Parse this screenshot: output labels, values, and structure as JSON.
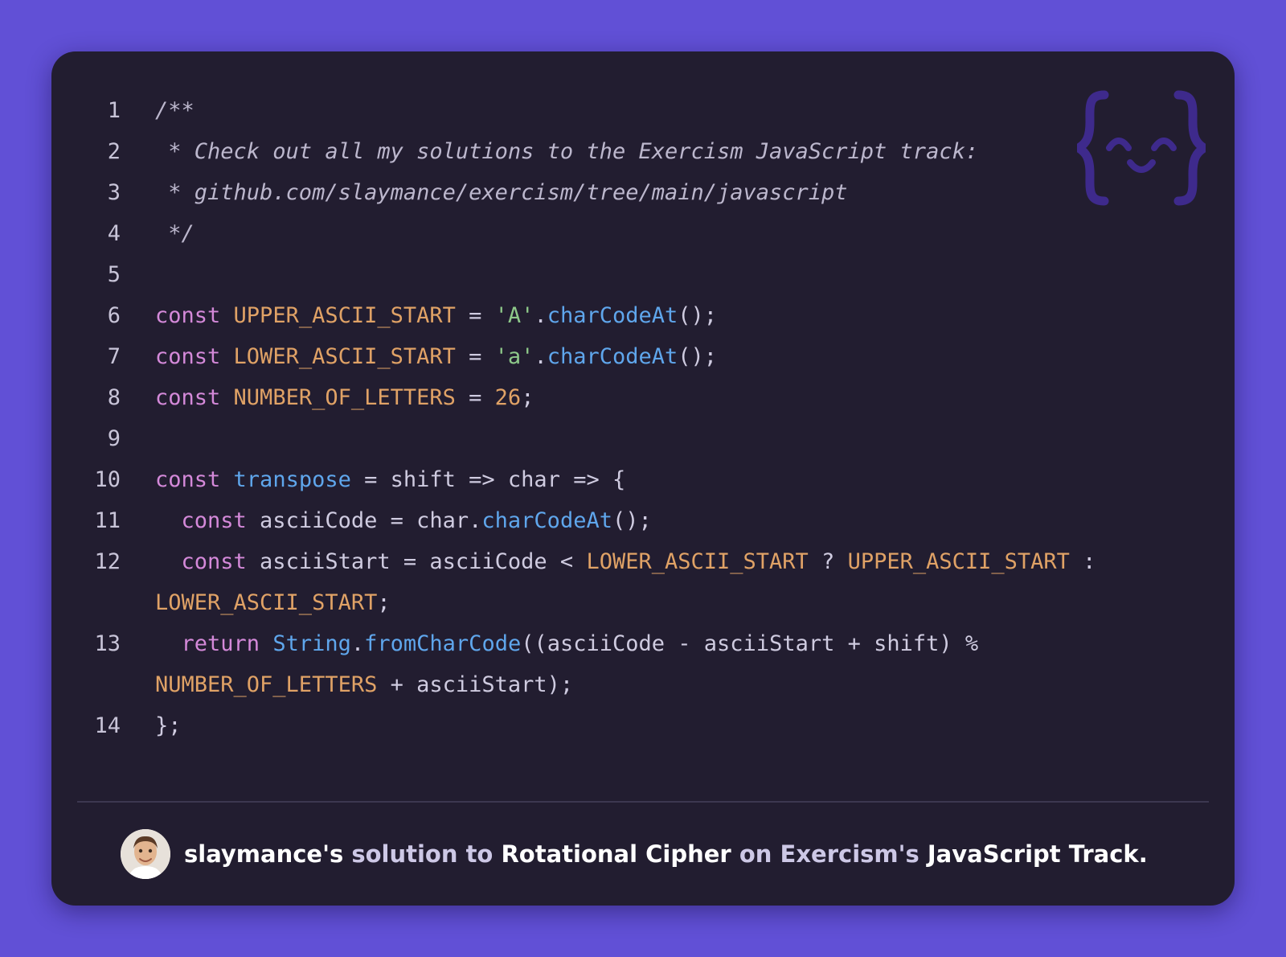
{
  "colors": {
    "background": "#6150d6",
    "card": "#221d30",
    "keyword": "#d489d9",
    "constant": "#e0a266",
    "function": "#5fa6ec",
    "string": "#8ec98a",
    "comment": "#bcb7cd",
    "text": "#cfcbe0"
  },
  "logo": {
    "icon": "exercism-curly-face-icon"
  },
  "code": {
    "line_numbers": [
      "1",
      "2",
      "3",
      "4",
      "5",
      "6",
      "7",
      "8",
      "9",
      "10",
      "11",
      "12",
      "13",
      "14"
    ],
    "lines": [
      [
        {
          "t": "cm",
          "v": "/**"
        }
      ],
      [
        {
          "t": "cm",
          "v": " * Check out all my solutions to the Exercism JavaScript track:"
        }
      ],
      [
        {
          "t": "cm",
          "v": " * github.com/slaymance/exercism/tree/main/javascript"
        }
      ],
      [
        {
          "t": "cm",
          "v": " */"
        }
      ],
      [],
      [
        {
          "t": "kw",
          "v": "const"
        },
        {
          "t": "tx",
          "v": " "
        },
        {
          "t": "cn",
          "v": "UPPER_ASCII_START"
        },
        {
          "t": "tx",
          "v": " = "
        },
        {
          "t": "st",
          "v": "'A'"
        },
        {
          "t": "tx",
          "v": "."
        },
        {
          "t": "fn",
          "v": "charCodeAt"
        },
        {
          "t": "tx",
          "v": "();"
        }
      ],
      [
        {
          "t": "kw",
          "v": "const"
        },
        {
          "t": "tx",
          "v": " "
        },
        {
          "t": "cn",
          "v": "LOWER_ASCII_START"
        },
        {
          "t": "tx",
          "v": " = "
        },
        {
          "t": "st",
          "v": "'a'"
        },
        {
          "t": "tx",
          "v": "."
        },
        {
          "t": "fn",
          "v": "charCodeAt"
        },
        {
          "t": "tx",
          "v": "();"
        }
      ],
      [
        {
          "t": "kw",
          "v": "const"
        },
        {
          "t": "tx",
          "v": " "
        },
        {
          "t": "cn",
          "v": "NUMBER_OF_LETTERS"
        },
        {
          "t": "tx",
          "v": " = "
        },
        {
          "t": "cn",
          "v": "26"
        },
        {
          "t": "tx",
          "v": ";"
        }
      ],
      [],
      [
        {
          "t": "kw",
          "v": "const"
        },
        {
          "t": "tx",
          "v": " "
        },
        {
          "t": "fn",
          "v": "transpose"
        },
        {
          "t": "tx",
          "v": " = shift => char => {"
        }
      ],
      [
        {
          "t": "tx",
          "v": "  "
        },
        {
          "t": "kw",
          "v": "const"
        },
        {
          "t": "tx",
          "v": " asciiCode = char."
        },
        {
          "t": "fn",
          "v": "charCodeAt"
        },
        {
          "t": "tx",
          "v": "();"
        }
      ],
      [
        {
          "t": "tx",
          "v": "  "
        },
        {
          "t": "kw",
          "v": "const"
        },
        {
          "t": "tx",
          "v": " asciiStart = asciiCode < "
        },
        {
          "t": "cn",
          "v": "LOWER_ASCII_START"
        },
        {
          "t": "tx",
          "v": " ? "
        },
        {
          "t": "cn",
          "v": "UPPER_ASCII_START"
        },
        {
          "t": "tx",
          "v": " :\n"
        },
        {
          "t": "cn",
          "v": "LOWER_ASCII_START"
        },
        {
          "t": "tx",
          "v": ";"
        }
      ],
      [
        {
          "t": "tx",
          "v": "  "
        },
        {
          "t": "kw",
          "v": "return"
        },
        {
          "t": "tx",
          "v": " "
        },
        {
          "t": "fn",
          "v": "String"
        },
        {
          "t": "tx",
          "v": "."
        },
        {
          "t": "fn",
          "v": "fromCharCode"
        },
        {
          "t": "tx",
          "v": "((asciiCode - asciiStart + shift) %\n"
        },
        {
          "t": "cn",
          "v": "NUMBER_OF_LETTERS"
        },
        {
          "t": "tx",
          "v": " + asciiStart);"
        }
      ],
      [
        {
          "t": "tx",
          "v": "};"
        }
      ]
    ]
  },
  "footer": {
    "avatar": "avatar-icon",
    "author": "slaymance's",
    "solution_to": "solution to",
    "exercise": "Rotational Cipher",
    "on": "on",
    "site": "Exercism's",
    "track": "JavaScript Track."
  }
}
